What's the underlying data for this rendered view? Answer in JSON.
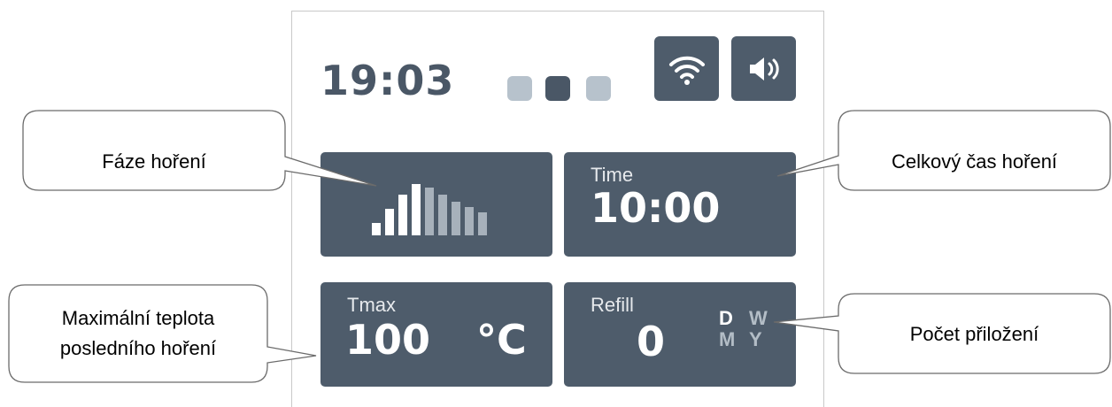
{
  "status_bar": {
    "clock": "19:03",
    "pager": {
      "count": 3,
      "active_index": 1
    },
    "wifi_icon": "wifi-icon",
    "sound_icon": "speaker-icon"
  },
  "tiles": {
    "burn_phase": {
      "icon": "burn-phase-bars-icon",
      "active_bars": 4,
      "total_bars": 9
    },
    "time": {
      "label": "Time",
      "value": "10:00"
    },
    "tmax": {
      "label": "Tmax",
      "value": "100",
      "unit": "°C"
    },
    "refill": {
      "label": "Refill",
      "value": "0",
      "periods": [
        "D",
        "W",
        "M",
        "Y"
      ],
      "active_period": "D"
    }
  },
  "callouts": {
    "burn_phase": "Fáze hoření",
    "total_time": "Celkový čas hoření",
    "max_temp_line1": "Maximální teplota",
    "max_temp_line2": "posledního hoření",
    "refill_count": "Počet přiložení"
  },
  "colors": {
    "tile_bg": "#4e5c6b",
    "text_dark": "#4a5766",
    "dot_inactive": "#b7c2cc",
    "bar_active": "#ffffff",
    "bar_inactive": "#a7b1bb",
    "period_inactive": "#b3bdc6"
  }
}
